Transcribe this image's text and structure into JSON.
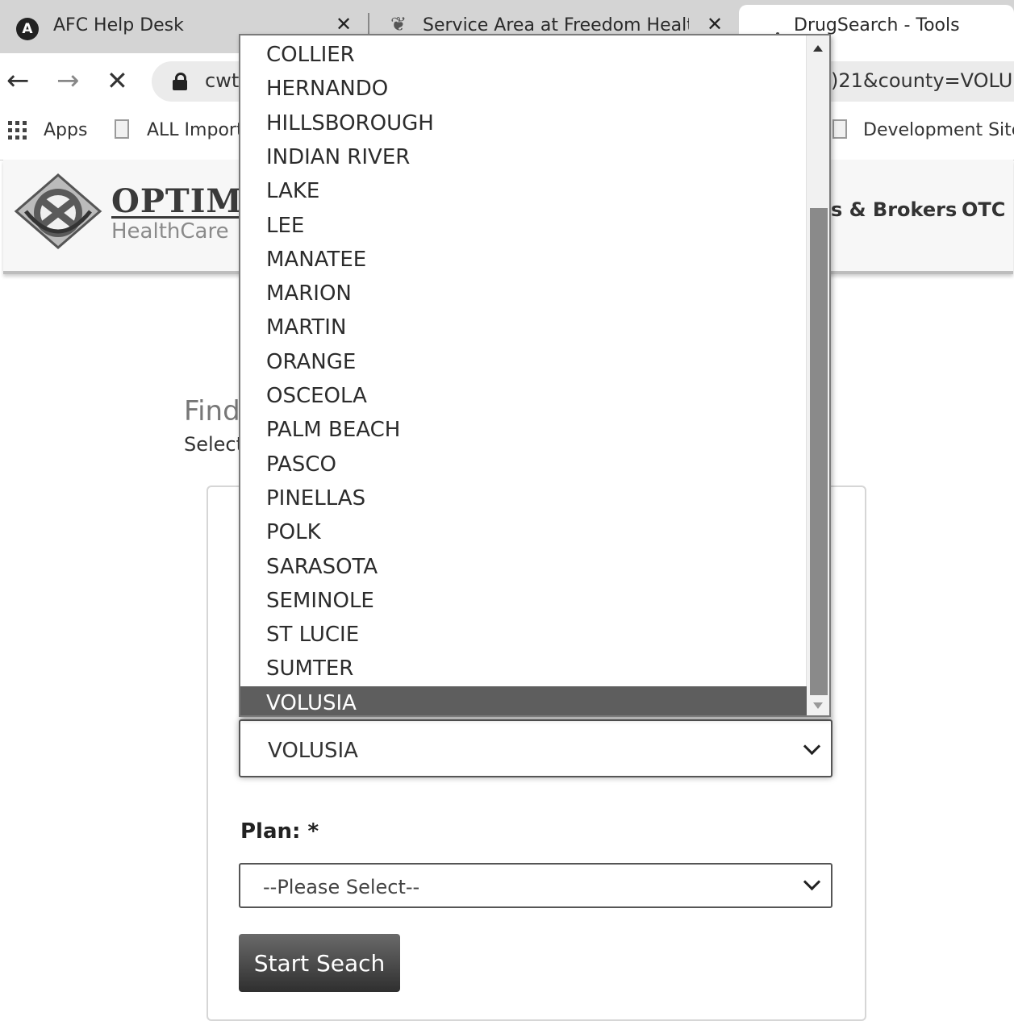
{
  "browser": {
    "tabs": [
      {
        "title": "AFC Help Desk",
        "favicon": "avast-logo-icon"
      },
      {
        "title": "Service Area at Freedom Health I",
        "favicon": "feather-icon"
      },
      {
        "title": "DrugSearch - Tools",
        "favicon": "loading-icon"
      }
    ],
    "url_start": "cwt",
    "url_end": ")21&county=VOLU"
  },
  "bookmarks": [
    {
      "label": "Apps",
      "icon": "apps-grid-icon"
    },
    {
      "label": "ALL Import",
      "icon": "page-icon"
    },
    {
      "label": "Development Site",
      "icon": "page-icon"
    }
  ],
  "site": {
    "logo_name": "OPTIMU",
    "logo_sub": "HealthCare",
    "nav": [
      "s & Brokers",
      "OTC"
    ]
  },
  "page": {
    "title": "Find",
    "subtitle": "Select"
  },
  "county_select": {
    "value": "VOLUSIA",
    "options": [
      "COLLIER",
      "HERNANDO",
      "HILLSBOROUGH",
      "INDIAN RIVER",
      "LAKE",
      "LEE",
      "MANATEE",
      "MARION",
      "MARTIN",
      "ORANGE",
      "OSCEOLA",
      "PALM BEACH",
      "PASCO",
      "PINELLAS",
      "POLK",
      "SARASOTA",
      "SEMINOLE",
      "ST LUCIE",
      "SUMTER",
      "VOLUSIA"
    ],
    "selected_index": 19
  },
  "plan_select": {
    "label": "Plan: *",
    "value": "--Please Select--"
  },
  "actions": {
    "start_label": "Start Seach"
  }
}
